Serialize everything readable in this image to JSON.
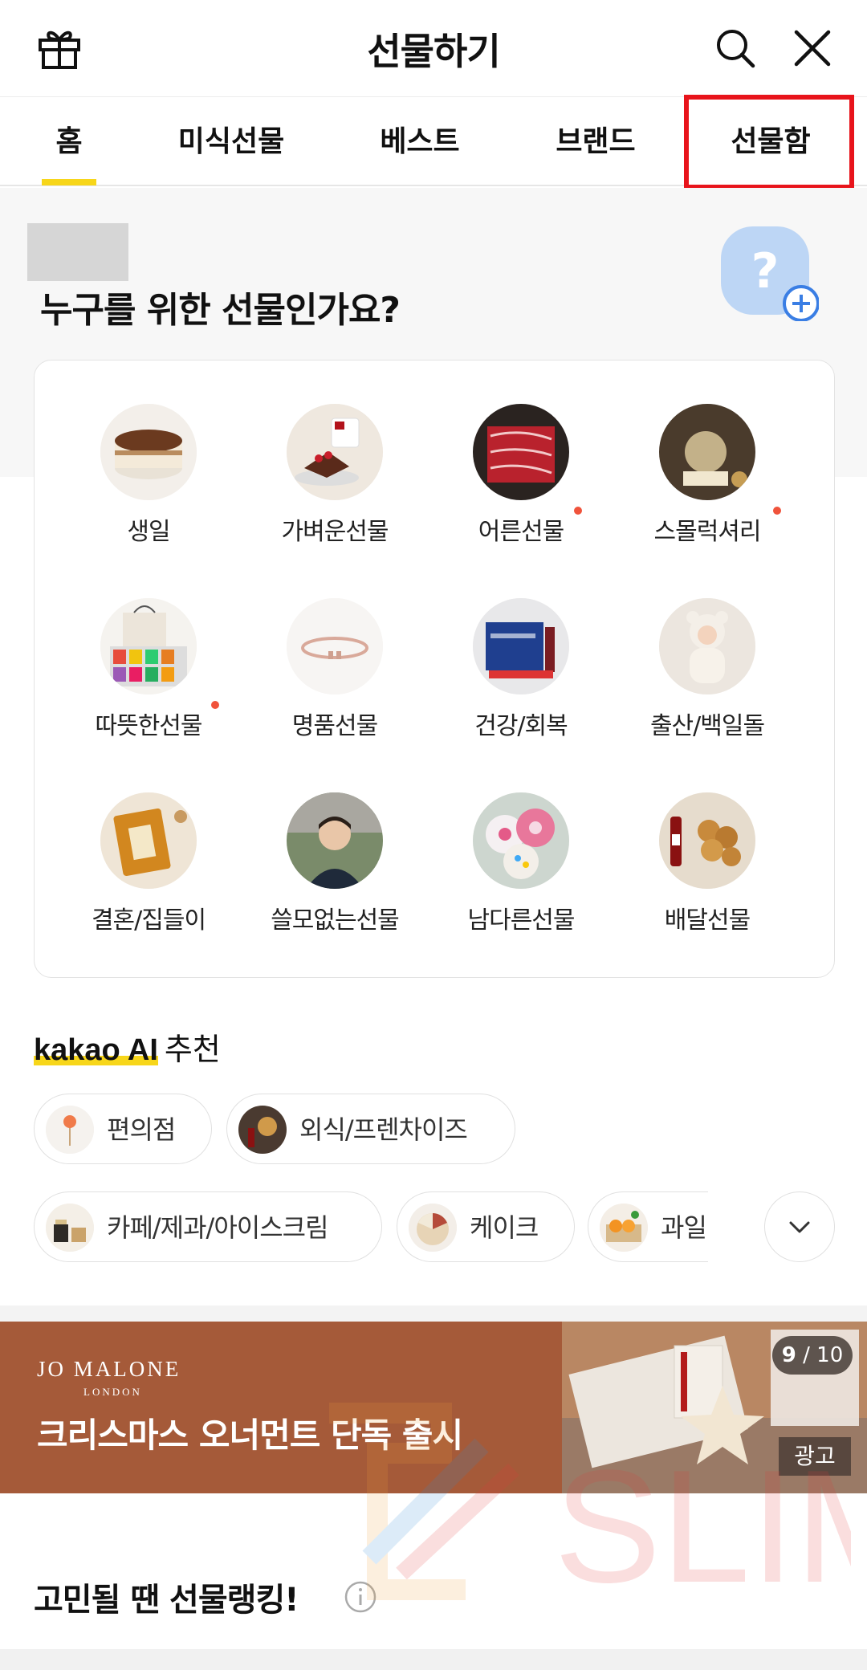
{
  "header": {
    "title": "선물하기"
  },
  "tabs": [
    {
      "label": "홈",
      "active": true
    },
    {
      "label": "미식선물"
    },
    {
      "label": "베스트"
    },
    {
      "label": "브랜드"
    },
    {
      "label": "선물함",
      "highlighted": true
    }
  ],
  "hero": {
    "question": "누구를 위한 선물인가요?"
  },
  "categories": [
    {
      "label": "생일",
      "icon": "cake-icon"
    },
    {
      "label": "가벼운선물",
      "icon": "coffee-icon"
    },
    {
      "label": "어른선물",
      "icon": "meat-icon",
      "new_dot": true
    },
    {
      "label": "스몰럭셔리",
      "icon": "teapot-icon",
      "new_dot": true
    },
    {
      "label": "따뜻한선물",
      "icon": "giftbox-icon",
      "new_dot": true
    },
    {
      "label": "명품선물",
      "icon": "bracelet-icon"
    },
    {
      "label": "건강/회복",
      "icon": "supplement-icon"
    },
    {
      "label": "출산/백일돌",
      "icon": "baby-icon"
    },
    {
      "label": "결혼/집들이",
      "icon": "perfume-icon"
    },
    {
      "label": "쓸모없는선물",
      "icon": "person-icon"
    },
    {
      "label": "남다른선물",
      "icon": "cake-donut-icon"
    },
    {
      "label": "배달선물",
      "icon": "chicken-icon"
    }
  ],
  "ai": {
    "brand": "kakao AI",
    "title": "추천"
  },
  "chips": [
    {
      "label": "편의점",
      "icon": "lollipop-icon"
    },
    {
      "label": "외식/프렌차이즈",
      "icon": "food-icon"
    },
    {
      "label": "카페/제과/아이스크림",
      "icon": "icecream-icon"
    },
    {
      "label": "케이크",
      "icon": "cake-slice-icon"
    },
    {
      "label": "과일",
      "icon": "fruit-icon"
    }
  ],
  "banner": {
    "brand": "JO MALONE",
    "brand_sub": "LONDON",
    "text": "크리스마스 오너먼트 단독 출시",
    "counter_current": "9",
    "counter_total": "/ 10",
    "ad_label": "광고"
  },
  "ranking": {
    "title": "고민될 땐 선물랭킹!"
  },
  "colors": {
    "accent_yellow": "#f7d61a",
    "highlight_red": "#e8141b",
    "banner_bg": "#a55a39",
    "new_dot": "#f0533b"
  }
}
